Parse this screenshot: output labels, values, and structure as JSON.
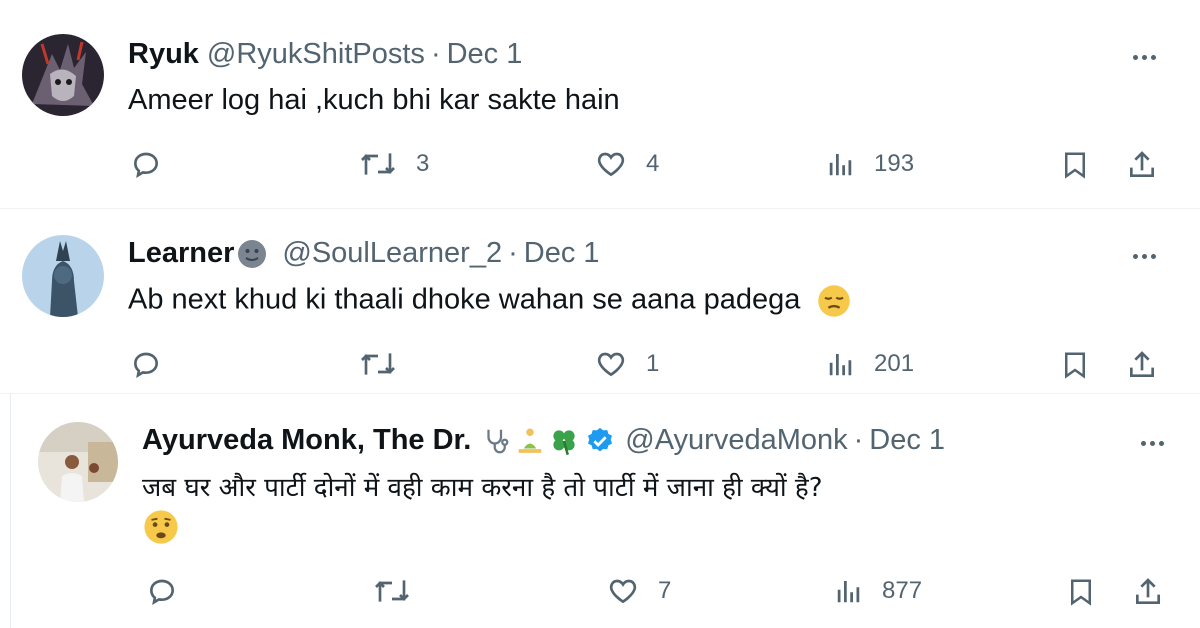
{
  "tweets": [
    {
      "name": "Ryuk",
      "handle": "@RyukShitPosts",
      "separator": "·",
      "date": "Dec 1",
      "text": "Ameer log hai ,kuch bhi kar sakte hain",
      "retweets": "3",
      "likes": "4",
      "views": "193"
    },
    {
      "name": "Learner",
      "handle": "@SoulLearner_2",
      "separator": "·",
      "date": "Dec 1",
      "text": "Ab next khud ki  thaali dhoke wahan se  aana padega",
      "retweets": "",
      "likes": "1",
      "views": "201"
    },
    {
      "name": "Ayurveda Monk, The Dr.",
      "handle": "@AyurvedaMonk",
      "separator": "·",
      "date": "Dec 1",
      "text": "जब घर और पार्टी दोनों में वही काम करना है तो पार्टी में जाना ही क्यों है?",
      "retweets": "",
      "likes": "7",
      "views": "877"
    }
  ],
  "colors": {
    "text": "#0f1419",
    "muted": "#536471",
    "verified": "#1d9bf0"
  },
  "icons": [
    "reply-icon",
    "retweet-icon",
    "like-icon",
    "views-icon",
    "bookmark-icon",
    "share-icon",
    "more-icon",
    "verified-badge-icon"
  ]
}
